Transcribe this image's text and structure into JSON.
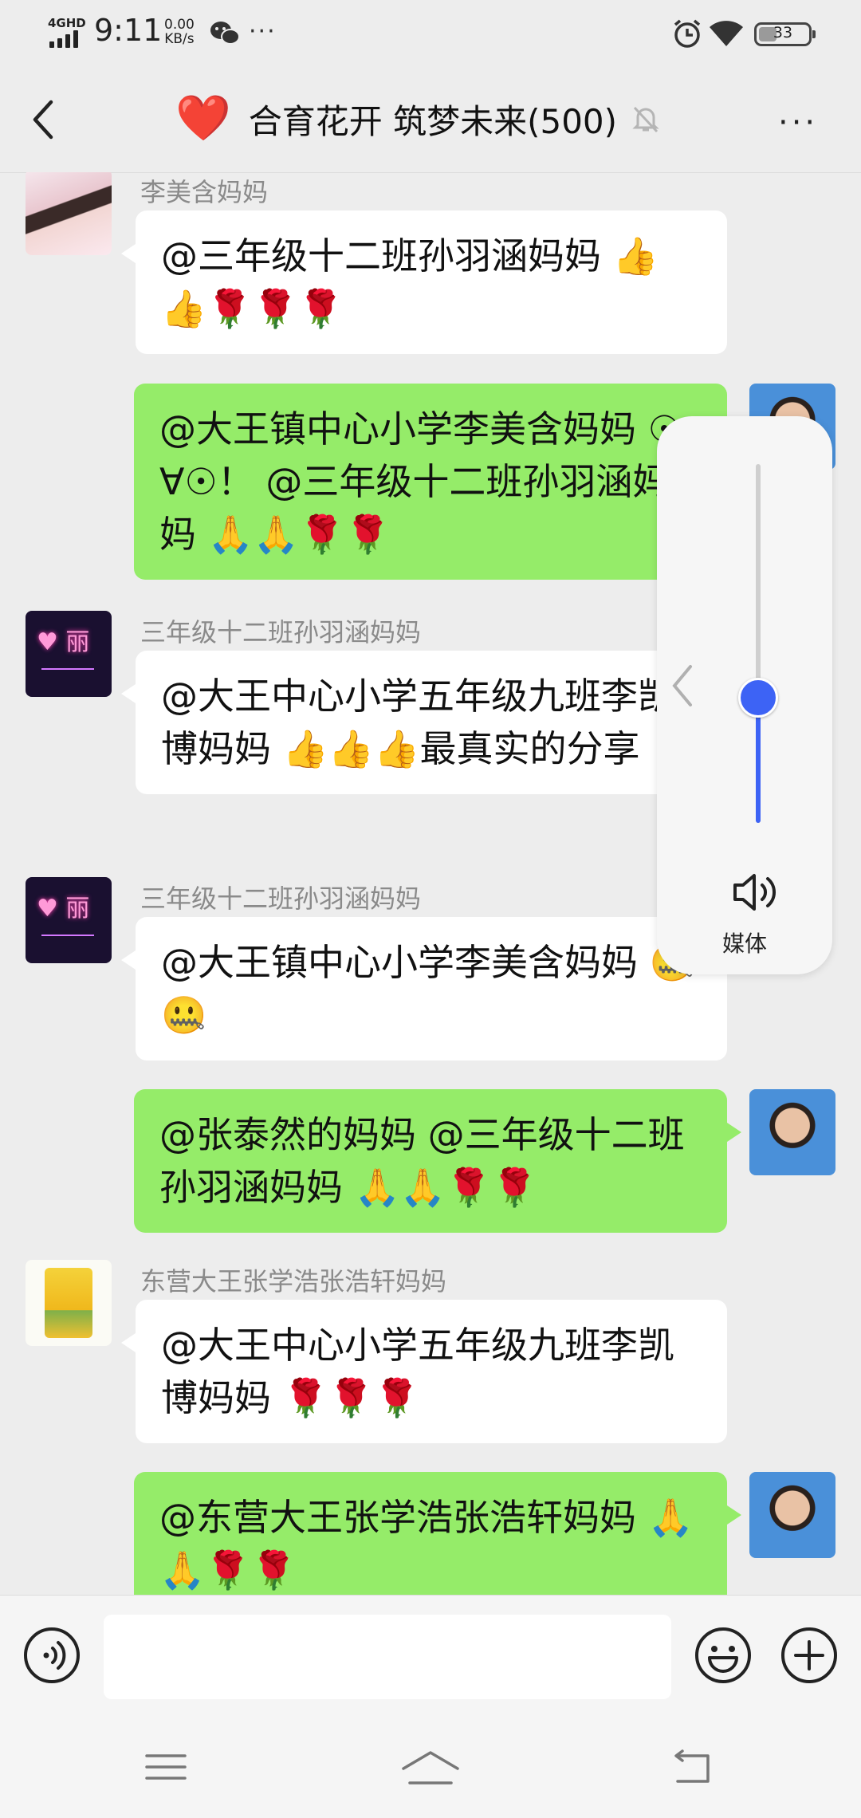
{
  "status_bar": {
    "network": "4GHD",
    "time": "9:11",
    "speed_value": "0.00",
    "speed_unit": "KB/s",
    "more": "···",
    "battery": "33"
  },
  "header": {
    "heart_icon": "❤️",
    "title": "合育花开 筑梦未来(500)",
    "more": "···"
  },
  "messages": [
    {
      "side": "in",
      "sender": "李美含妈妈",
      "text": "@三年级十二班孙羽涵妈妈 👍👍🌹🌹🌹",
      "avatar": "girl-photo-avatar"
    },
    {
      "side": "out",
      "text": "@大王镇中心小学李美含妈妈 ☉∀☉！ @三年级十二班孙羽涵妈妈 🙏🙏🌹🌹",
      "avatar": "woman-photo-avatar"
    },
    {
      "side": "in",
      "sender": "三年级十二班孙羽涵妈妈",
      "text": "@大王中心小学五年级九班李凯博妈妈 👍👍👍最真实的分享",
      "avatar": "neon-li-avatar"
    },
    {
      "side": "in",
      "sender": "三年级十二班孙羽涵妈妈",
      "text": "@大王镇中心小学李美含妈妈 🤐🤐",
      "avatar": "neon-li-avatar"
    },
    {
      "side": "out",
      "text": "@张泰然的妈妈 @三年级十二班孙羽涵妈妈 🙏🙏🌹🌹",
      "avatar": "woman-photo-avatar"
    },
    {
      "side": "in",
      "sender": "东营大王张学浩张浩轩妈妈",
      "text": "@大王中心小学五年级九班李凯博妈妈 🌹🌹🌹",
      "avatar": "product-bag-avatar"
    },
    {
      "side": "out",
      "text": "@东营大王张学浩张浩轩妈妈 🙏🙏🌹🌹",
      "avatar": "woman-photo-avatar"
    }
  ],
  "volume_panel": {
    "label": "媒体",
    "level": 0.35
  },
  "colors": {
    "outgoing_bubble": "#95ec69",
    "incoming_bubble": "#ffffff",
    "background": "#ededed",
    "volume_accent": "#3d63f5"
  }
}
